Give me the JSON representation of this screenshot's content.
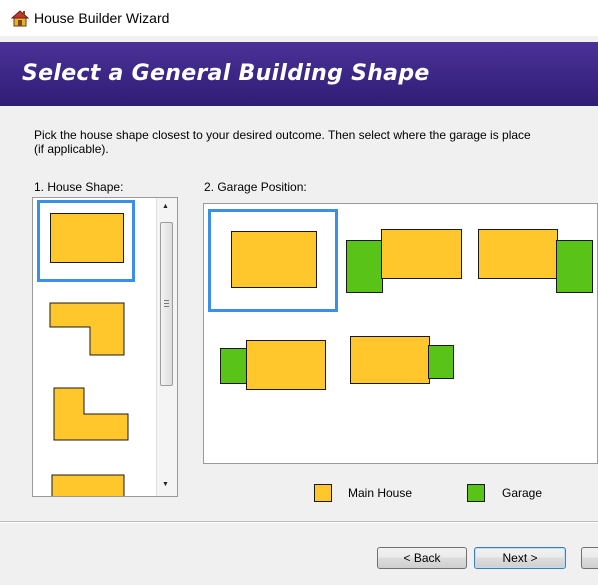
{
  "window": {
    "title": "House Builder Wizard",
    "icon": "house-icon"
  },
  "header": {
    "title": "Select a General Building Shape"
  },
  "instructions": {
    "line1": "Pick the house shape closest to your desired outcome. Then select where the garage is place",
    "line2": "(if applicable)."
  },
  "shape_list": {
    "label": "1. House Shape:",
    "selected_index": 0
  },
  "garage_list": {
    "label": "2. Garage Position:",
    "selected_index": 0
  },
  "legend": {
    "main_house": "Main House",
    "garage": "Garage"
  },
  "colors": {
    "main_house": "#ffc72c",
    "garage": "#5ac318",
    "selection": "#3a8fe6",
    "header": "#3a2583"
  },
  "buttons": {
    "back": "< Back",
    "next": "Next >"
  }
}
